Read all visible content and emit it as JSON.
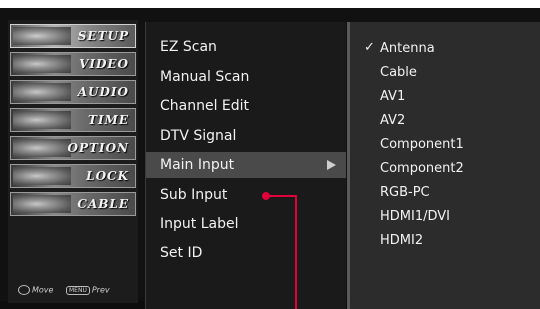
{
  "tabs": [
    {
      "label": "SETUP",
      "icon": "setup-icon",
      "selected": true
    },
    {
      "label": "VIDEO",
      "icon": "video-icon",
      "selected": false
    },
    {
      "label": "AUDIO",
      "icon": "audio-icon",
      "selected": false
    },
    {
      "label": "TIME",
      "icon": "time-icon",
      "selected": false
    },
    {
      "label": "OPTION",
      "icon": "option-icon",
      "selected": false
    },
    {
      "label": "LOCK",
      "icon": "lock-icon",
      "selected": false
    },
    {
      "label": "CABLE",
      "icon": "cable-icon",
      "selected": false
    }
  ],
  "footer": {
    "move_label": "Move",
    "prev_label": "Prev",
    "menu_key": "MENU"
  },
  "menu": {
    "items": [
      {
        "label": "EZ Scan"
      },
      {
        "label": "Manual Scan"
      },
      {
        "label": "Channel Edit"
      },
      {
        "label": "DTV Signal"
      },
      {
        "label": "Main Input",
        "highlighted": true,
        "has_submenu": true
      },
      {
        "label": "Sub Input"
      },
      {
        "label": "Input Label"
      },
      {
        "label": "Set ID"
      }
    ]
  },
  "submenu": {
    "check_mark": "✓",
    "options": [
      {
        "label": "Antenna",
        "checked": true
      },
      {
        "label": "Cable",
        "checked": false
      },
      {
        "label": "AV1",
        "checked": false
      },
      {
        "label": "AV2",
        "checked": false
      },
      {
        "label": "Component1",
        "checked": false
      },
      {
        "label": "Component2",
        "checked": false
      },
      {
        "label": "RGB-PC",
        "checked": false
      },
      {
        "label": "HDMI1/DVI",
        "checked": false
      },
      {
        "label": "HDMI2",
        "checked": false
      }
    ]
  },
  "colors": {
    "pointer": "#e0003a",
    "highlight": "#4a4a4a",
    "menu_bg": "#1a1a1a",
    "submenu_bg": "#2c2c2c"
  }
}
